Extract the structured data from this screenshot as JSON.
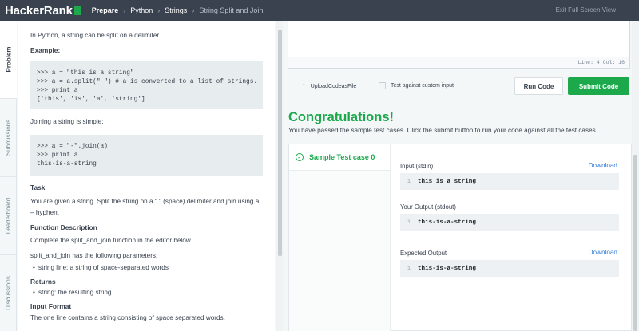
{
  "topbar": {
    "logo_text": "HackerRank",
    "breadcrumbs": [
      "Prepare",
      "Python",
      "Strings",
      "String Split and Join"
    ],
    "exit_label": "Exit Full Screen View"
  },
  "vtabs": [
    "Problem",
    "Submissions",
    "Leaderboard",
    "Discussions"
  ],
  "problem": {
    "intro": "In Python, a string can be split on a delimiter.",
    "example_heading": "Example:",
    "code1": ">>> a = \"this is a string\"\n>>> a = a.split(\" \") # a is converted to a list of strings.\n>>> print a\n['this', 'is', 'a', 'string']",
    "join_text": "Joining a string is simple:",
    "code2": ">>> a = \"-\".join(a)\n>>> print a\nthis-is-a-string",
    "task_heading": "Task",
    "task_text": "You are given a string. Split the string on a \" \" (space) delimiter and join using a – hyphen.",
    "func_heading": "Function Description",
    "func_text": "Complete the split_and_join function in the editor below.",
    "params_text": "split_and_join has the following parameters:",
    "param_item": "string line: a string of space-separated words",
    "returns_heading": "Returns",
    "returns_item": "string: the resulting string",
    "input_heading": "Input Format",
    "input_text": "The one line contains a string consisting of space separated words."
  },
  "editor": {
    "status": "Line: 4 Col: 16"
  },
  "actions": {
    "upload_label": "UploadCodeasFile",
    "custom_input_label": "Test against custom input",
    "run_label": "Run Code",
    "submit_label": "Submit Code"
  },
  "result": {
    "title": "Congratulations!",
    "message": "You have passed the sample test cases. Click the submit button to run your code against all the test cases.",
    "testcase_label": "Sample Test case 0",
    "input_label": "Input (stdin)",
    "input_value": "this is a string",
    "output_label": "Your Output (stdout)",
    "output_value": "this-is-a-string",
    "expected_label": "Expected Output",
    "expected_value": "this-is-a-string",
    "download_label": "Download",
    "line_number": "1"
  },
  "colors": {
    "accent_green": "#1ba94c",
    "topbar": "#39424e",
    "link_blue": "#2f7ad8"
  },
  "icons": [
    "upload-icon",
    "check-circle-icon"
  ]
}
